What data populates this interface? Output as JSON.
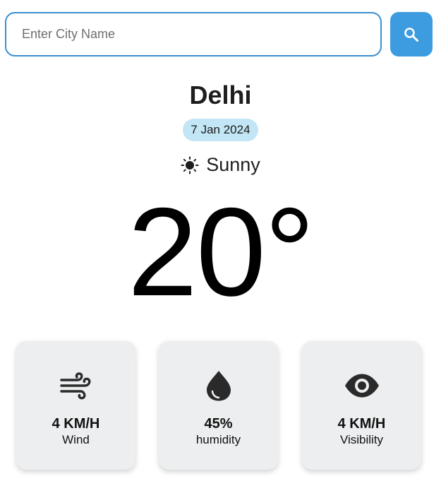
{
  "search": {
    "placeholder": "Enter City Name",
    "value": "",
    "button_icon": "search-icon",
    "button_color": "#3d9be0",
    "border_color": "#3a8fd0"
  },
  "weather": {
    "city": "Delhi",
    "date": "7 Jan 2024",
    "date_badge_color": "#c2e6f5",
    "condition": "Sunny",
    "condition_icon": "sun-icon",
    "temperature": "20°"
  },
  "stats": [
    {
      "value": "4 KM/H",
      "label": "Wind",
      "icon": "wind-icon"
    },
    {
      "value": "45%",
      "label": "humidity",
      "icon": "water-drop-icon"
    },
    {
      "value": "4 KM/H",
      "label": "Visibility",
      "icon": "eye-icon"
    }
  ],
  "colors": {
    "card_background": "#eceeef",
    "icon_color": "#2a2a2a"
  }
}
